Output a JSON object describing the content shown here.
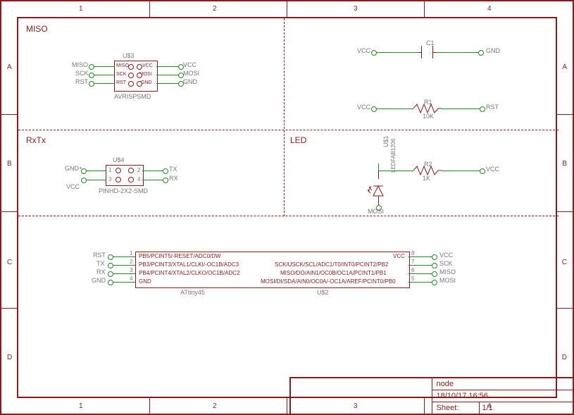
{
  "sections": {
    "miso": "MISO",
    "rxtx": "RxTx",
    "led": "LED"
  },
  "grid": {
    "cols": [
      "1",
      "2",
      "3",
      "4"
    ],
    "rows": [
      "A",
      "B",
      "C",
      "D"
    ]
  },
  "title_block": {
    "project": "node",
    "date": "18/10/17 16:56",
    "sheet_label": "Sheet:",
    "sheet_value": "1/1"
  },
  "u3": {
    "ref": "U$3",
    "name": "AVRISPSMD",
    "pins": {
      "miso": "MISO",
      "sck": "SCK",
      "rst": "RST",
      "vcc": "VCC",
      "mosi": "MOSI",
      "gnd": "GND"
    }
  },
  "u4": {
    "ref": "U$4",
    "name": "PINHD-2X2-SMD",
    "pins": {
      "p1": "1",
      "p2": "2",
      "p3": "3",
      "p4": "4"
    }
  },
  "u2": {
    "ref": "U$2",
    "name": "ATtiny45",
    "left_pins": [
      {
        "n": "1",
        "t": "PB5/PCINT5/-RESET/ADC0/DW"
      },
      {
        "n": "2",
        "t": "PB3/PCINT3/XTAL1/CLKI/-OC1B/ADC3"
      },
      {
        "n": "3",
        "t": "PB4/PCINT4/XTAL2/CLKO/OC1B/ADC2"
      },
      {
        "n": "4",
        "t": "GND"
      }
    ],
    "right_pins": [
      {
        "n": "8",
        "t": "VCC"
      },
      {
        "n": "7",
        "t": "SCK/USCK/SCL/ADC1/T0/INT0/PCINT2/PB2"
      },
      {
        "n": "6",
        "t": "MISO/DO/AIN1/OC0B/OC1A/PCINT1/PB1"
      },
      {
        "n": "5",
        "t": "MOSI/DI/SDA/AIN0/OC0A/-OC1A/AREF/PCINT0/PB0"
      }
    ]
  },
  "nets": {
    "miso": "MISO",
    "sck": "SCK",
    "rst": "RST",
    "vcc": "VCC",
    "mosi": "MOSI",
    "gnd": "GND",
    "tx": "TX",
    "rx": "RX"
  },
  "c1": {
    "ref": "C1"
  },
  "r1": {
    "ref": "R1",
    "val": "10K"
  },
  "r2": {
    "ref": "R2",
    "val": "1K"
  },
  "led_part": {
    "ref": "U$1",
    "name": "LEDFAB1206"
  }
}
